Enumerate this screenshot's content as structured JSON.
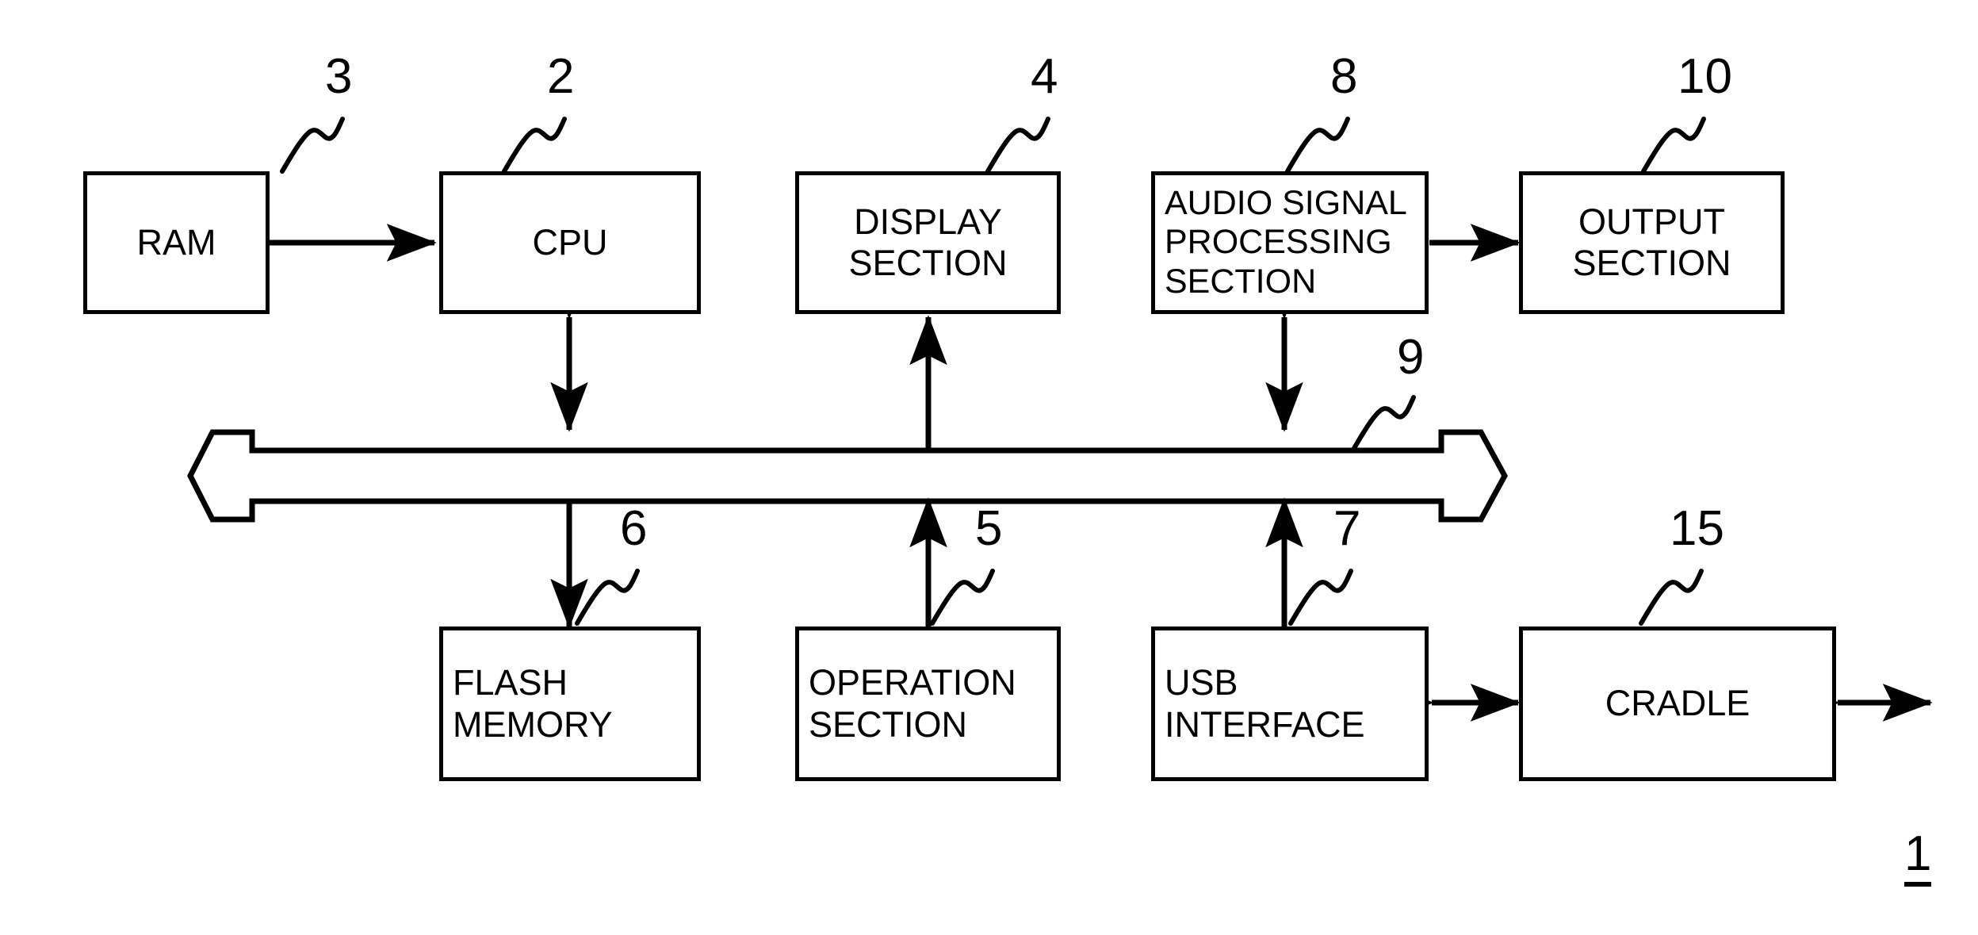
{
  "figure": {
    "title": "Device block diagram",
    "overall_reference_label": "1",
    "line_color": "#000000",
    "background_color": "#ffffff"
  },
  "blocks": [
    {
      "id": "ram",
      "ref": "3",
      "lines": [
        "RAM"
      ],
      "align": "center"
    },
    {
      "id": "cpu",
      "ref": "2",
      "lines": [
        "CPU"
      ],
      "align": "center"
    },
    {
      "id": "display",
      "ref": "4",
      "lines": [
        "DISPLAY",
        "SECTION"
      ],
      "align": "center"
    },
    {
      "id": "audio",
      "ref": "8",
      "lines": [
        "AUDIO SIGNAL",
        "PROCESSING",
        "SECTION"
      ],
      "align": "left"
    },
    {
      "id": "output",
      "ref": "10",
      "lines": [
        "OUTPUT",
        "SECTION"
      ],
      "align": "center"
    },
    {
      "id": "flash",
      "ref": "6",
      "lines": [
        "FLASH",
        "MEMORY"
      ],
      "align": "left"
    },
    {
      "id": "operation",
      "ref": "5",
      "lines": [
        "OPERATION",
        "SECTION"
      ],
      "align": "left"
    },
    {
      "id": "usb",
      "ref": "7",
      "lines": [
        "USB",
        "INTERFACE"
      ],
      "align": "left"
    },
    {
      "id": "cradle",
      "ref": "15",
      "lines": [
        "CRADLE"
      ],
      "align": "center"
    }
  ],
  "bus": {
    "ref": "9",
    "description": "bidirectional system bus"
  },
  "connections": [
    {
      "from": "ram",
      "to": "cpu",
      "type": "bidirectional"
    },
    {
      "from": "cpu",
      "to": "bus",
      "type": "bidirectional"
    },
    {
      "from": "bus",
      "to": "display",
      "type": "unidirectional"
    },
    {
      "from": "audio",
      "to": "bus",
      "type": "bidirectional"
    },
    {
      "from": "audio",
      "to": "output",
      "type": "unidirectional"
    },
    {
      "from": "bus",
      "to": "flash",
      "type": "unidirectional"
    },
    {
      "from": "operation",
      "to": "bus",
      "type": "unidirectional"
    },
    {
      "from": "usb",
      "to": "bus",
      "type": "unidirectional"
    },
    {
      "from": "usb",
      "to": "cradle",
      "type": "bidirectional"
    },
    {
      "from": "cradle",
      "to": "external",
      "type": "bidirectional"
    }
  ]
}
